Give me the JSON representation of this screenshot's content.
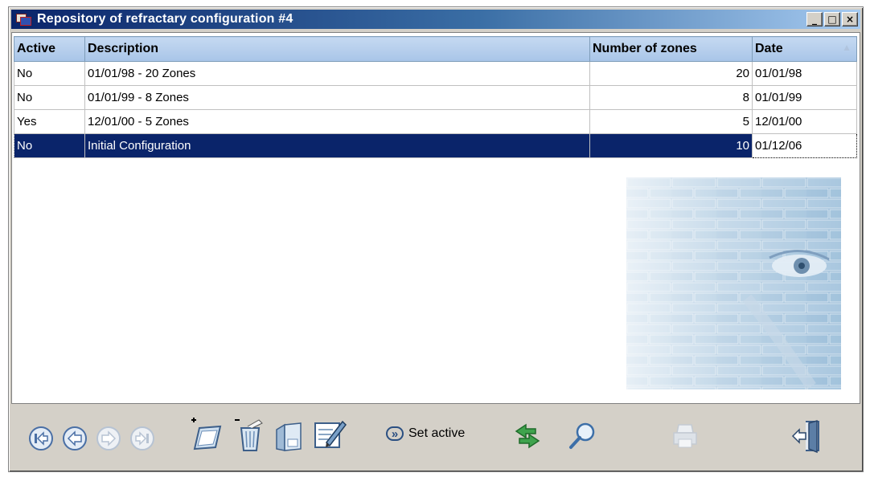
{
  "window": {
    "title": "Repository of refractary configuration #4",
    "buttons": {
      "minimize": "_",
      "maximize": "□",
      "close": "×"
    }
  },
  "table": {
    "columns": [
      "Active",
      "Description",
      "Number of zones",
      "Date"
    ],
    "sort_indicator": "▲",
    "rows": [
      {
        "active": "No",
        "description": "01/01/98 - 20 Zones",
        "zones": "20",
        "date": "01/01/98"
      },
      {
        "active": "No",
        "description": "01/01/99 - 8 Zones",
        "zones": "8",
        "date": "01/01/99"
      },
      {
        "active": "Yes",
        "description": "12/01/00 - 5 Zones",
        "zones": "5",
        "date": "12/01/00"
      },
      {
        "active": "No",
        "description": "Initial Configuration",
        "zones": "10",
        "date": "01/12/06"
      }
    ],
    "selected_row": 3
  },
  "toolbar": {
    "set_active_label": "Set active",
    "set_active_glyph": "»"
  },
  "colors": {
    "selection": "#0a246a",
    "header": "#a8c5e8",
    "window_face": "#d4d0c8",
    "brick": "#b9d1e4"
  }
}
